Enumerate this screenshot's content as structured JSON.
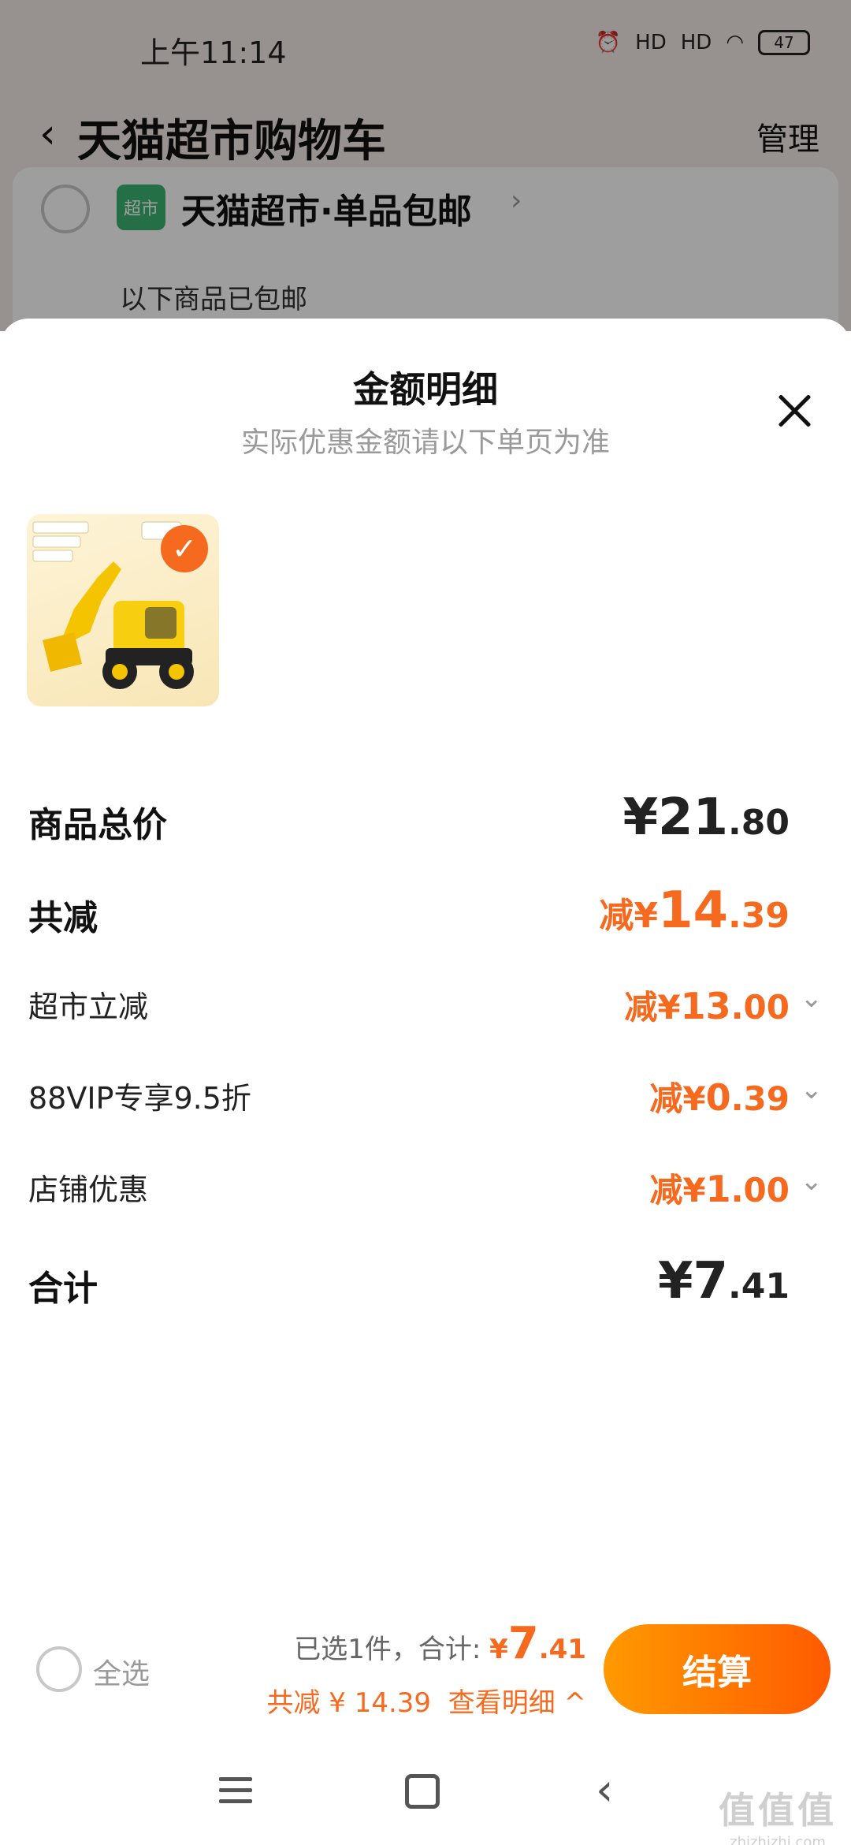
{
  "status_bar": {
    "time": "上午11:14",
    "signal1": "HD",
    "signal2": "HD",
    "battery": "47"
  },
  "nav": {
    "back_icon": "chevron-left-icon",
    "title": "天猫超市购物车",
    "manage": "管理"
  },
  "store": {
    "logo_text": "超市",
    "name": "天猫超市·单品包邮",
    "chevron": "›",
    "note": "以下商品已包邮"
  },
  "sheet": {
    "title": "金额明细",
    "subtitle": "实际优惠金额请以下单页为准",
    "product_check": "✓",
    "rows": [
      {
        "label": "商品总价",
        "currency": "¥",
        "int": "21",
        "dec": ".80"
      },
      {
        "label": "共减",
        "prefix": "减¥",
        "int": "14",
        "dec": ".39"
      },
      {
        "label": "超市立减",
        "prefix": "减¥",
        "int": "13",
        "dec": ".00"
      },
      {
        "label": "88VIP专享9.5折",
        "prefix": "减¥",
        "int": "0",
        "dec": ".39"
      },
      {
        "label": "店铺优惠",
        "prefix": "减¥",
        "int": "1",
        "dec": ".00"
      },
      {
        "label": "合计",
        "currency": "¥",
        "int": "7",
        "dec": ".41"
      }
    ]
  },
  "bottom": {
    "select_all": "全选",
    "selected_text": "已选1件，合计:",
    "total_currency": "¥",
    "total_int": "7",
    "total_dec": ".41",
    "discount_text": "共减 ¥ 14.39",
    "detail_link": "查看明细 ^",
    "checkout": "结算"
  },
  "watermark": {
    "big": "值值值",
    "small": "zhizhizhi.com"
  },
  "colors": {
    "accent": "#f56a1f",
    "checkout_start": "#ff9a00",
    "checkout_end": "#ff5a00"
  }
}
